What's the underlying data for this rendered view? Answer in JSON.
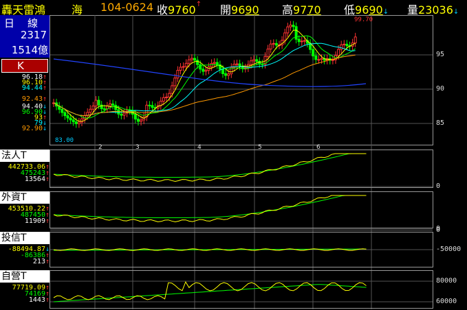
{
  "header": {
    "name": "轟天雷鴻",
    "market": "海",
    "date": "104-0624",
    "close_label": "收",
    "close": "9760",
    "close_arrow": "↑",
    "open_label": "開",
    "open_a": "96",
    "open_b": "90",
    "high_label": "高",
    "high_a": "97",
    "high_b": "70",
    "low_label": "低",
    "low_a": "96",
    "low_b": "90",
    "low_arrow": "↓",
    "vol_label": "量",
    "vol": "23036",
    "vol_arrow": "↓"
  },
  "info": {
    "period": "日　線",
    "code": "2317",
    "amount": "1514億",
    "k_label": "K"
  },
  "ma_values": [
    {
      "v": "96.18",
      "c": "#ffffff",
      "a": "↑"
    },
    {
      "v": "96.10",
      "c": "#ffff00",
      "a": "↑"
    },
    {
      "v": "94.44",
      "c": "#00ffff",
      "a": "↑"
    },
    {
      "v": "",
      "c": "#0000ff",
      "a": ""
    },
    {
      "v": "92.43",
      "c": "#ff9900",
      "a": "↑"
    }
  ],
  "vol_values": [
    {
      "v": "94.40",
      "c": "#ffffff",
      "a": "↓"
    },
    {
      "v": "96.90",
      "c": "#00ff00",
      "a": "↓"
    },
    {
      "v": "93",
      "c": "#ffff00",
      "a": "↑"
    },
    {
      "v": "79",
      "c": "#00ffff",
      "a": "↓"
    },
    {
      "v": "92.90",
      "c": "#ff9900",
      "a": "↓"
    }
  ],
  "price_axis": [
    "95",
    "90",
    "85"
  ],
  "high_marker": "99.70",
  "low_marker": "83.00",
  "x_labels": [
    "2",
    "3",
    "4",
    "5",
    "6"
  ],
  "panels": [
    {
      "title": "法人T",
      "v1": "442733.06",
      "v1a": "↑",
      "v2": "475243",
      "v2a": "↑",
      "v3": "13564",
      "v3a": "↑",
      "axis": [
        "0"
      ]
    },
    {
      "title": "外資T",
      "v1": "453510.22",
      "v1a": "↑",
      "v2": "487450",
      "v2a": "↑",
      "v3": "11909",
      "v3a": "↑",
      "axis": [
        "0"
      ]
    },
    {
      "title": "投信T",
      "v1": "-88494.87",
      "v1a": "↓",
      "v2": "-86386",
      "v2a": "↑",
      "v3": "213",
      "v3a": "↑",
      "axis": [
        "0",
        "-50000"
      ]
    },
    {
      "title": "自營T",
      "v1": "77719.09",
      "v1a": "↑",
      "v2": "74169",
      "v2a": "↑",
      "v3": "1443",
      "v3a": "↑",
      "axis": [
        "80000",
        "60000"
      ]
    }
  ]
}
